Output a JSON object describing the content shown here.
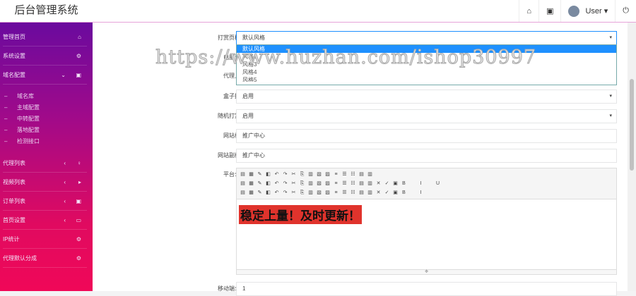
{
  "header": {
    "brand": "后台管理系统",
    "user": "User"
  },
  "sidebar": {
    "items": [
      {
        "label": "管理首页",
        "icon": "⌂"
      },
      {
        "label": "系统设置",
        "icon": "⚙"
      },
      {
        "label": "域名配置",
        "icon": "▣",
        "chevron": "⌄"
      }
    ],
    "sub": [
      "域名库",
      "主域配置",
      "中转配置",
      "落地配置",
      "检测接口"
    ],
    "items2": [
      {
        "label": "代理列表",
        "icon": "♀",
        "chevron": "‹"
      },
      {
        "label": "视频列表",
        "icon": "▸",
        "chevron": "‹"
      },
      {
        "label": "订单列表",
        "icon": "▣",
        "chevron": "‹"
      },
      {
        "label": "首页设置",
        "icon": "▭",
        "chevron": "‹"
      },
      {
        "label": "IP统计",
        "icon": "⚙"
      },
      {
        "label": "代理默认分成",
        "icon": "⚙"
      }
    ]
  },
  "form": {
    "template": {
      "label": "打赏页模板",
      "value": "默认风格",
      "options": [
        "默认风格",
        "风格2",
        "风格3",
        "风格4",
        "风格5"
      ]
    },
    "pc": {
      "label": "电脑访问"
    },
    "upload": {
      "label": "代理上传"
    },
    "box": {
      "label": "盒子推广",
      "value": "启用"
    },
    "random": {
      "label": "随机打赏数",
      "value": "启用"
    },
    "title": {
      "label": "网站标题",
      "value": "推广中心"
    },
    "subtitle": {
      "label": "网站副标题",
      "value": "推广中心"
    },
    "notice": {
      "label": "平台公告",
      "content": "稳定上量！及时更新！"
    },
    "mobile": {
      "label": "移动端公告",
      "value": "1"
    }
  },
  "watermark": "https://www.huzhan.com/ishop30997"
}
